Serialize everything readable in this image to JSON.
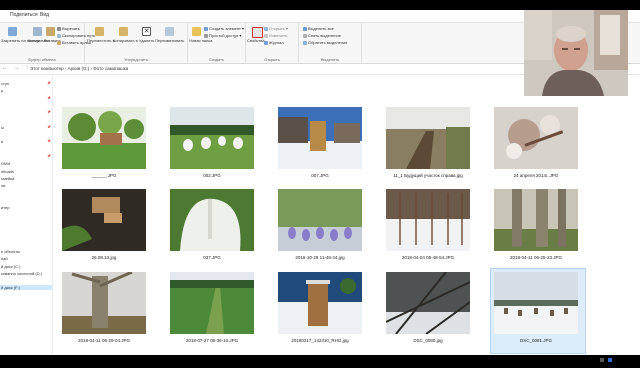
{
  "ribbon_tabs": [
    "Поделиться",
    "Вид"
  ],
  "ribbon": {
    "clipboard": {
      "group_label": "Буфер обмена",
      "pin_label": "Закрепить на панели",
      "copy_label": "Копировать",
      "paste_label": "Вставить",
      "cut_label": "Вырезать",
      "copy_path_label": "Скопировать путь",
      "paste_shortcut_label": "Вставить ярлык"
    },
    "organize": {
      "group_label": "Упорядочить",
      "move_label": "Переместить в",
      "copy_to_label": "Копировать в",
      "delete_label": "Удалить",
      "rename_label": "Переименовать"
    },
    "new": {
      "group_label": "Создать",
      "new_folder_label": "Новая папка",
      "new_item_label": "Создать элемент",
      "easy_access_label": "Простой доступ"
    },
    "open": {
      "group_label": "Открыть",
      "properties_label": "Свойства",
      "open_label": "Открыть",
      "edit_label": "Изменить",
      "history_label": "Журнал"
    },
    "select": {
      "group_label": "Выделить",
      "select_all_label": "Выделить все",
      "select_none_label": "Снять выделение",
      "invert_label": "Обратить выделение"
    }
  },
  "address": {
    "breadcrumb": "Этот компьютер › Архив (G:) › Фото самопашка"
  },
  "nav": {
    "items": [
      "ступ",
      "р",
      "",
      "",
      "",
      "",
      "ы",
      "",
      "в",
      "",
      "",
      "ОМИ",
      "ntloads",
      "смейки",
      "ов",
      "",
      "",
      "итер",
      "",
      "",
      "",
      "",
      "",
      "е объекты",
      "пай",
      "й диск (С:)",
      "кованно сисесной (D:)",
      "",
      "й диск (F:)"
    ],
    "selected_index": 28
  },
  "files": [
    {
      "caption": "______.JPG",
      "scene": "garden"
    },
    {
      "caption": "002.JPG",
      "scene": "field"
    },
    {
      "caption": "007.JPG",
      "scene": "snowhouse"
    },
    {
      "caption": "11_1 Будущий участок справа.jpg",
      "scene": "path"
    },
    {
      "caption": "24 апреля 2014г..JPG",
      "scene": "blossom"
    },
    {
      "caption": "26.08.10.jpg",
      "scene": "dirt"
    },
    {
      "caption": "037.JPG",
      "scene": "white"
    },
    {
      "caption": "2016-10-29 11-48-44.jpg",
      "scene": "purple"
    },
    {
      "caption": "2018-04-04 05-48-54.JPG",
      "scene": "snowrows"
    },
    {
      "caption": "2018-04-11 06-25-23.JPG",
      "scene": "trunks"
    },
    {
      "caption": "2018-04-11 06-29-04.JPG",
      "scene": "bigtree"
    },
    {
      "caption": "2018-07-27 06-36-10.JPG",
      "scene": "grass"
    },
    {
      "caption": "20180317_142310_RHG.jpg",
      "scene": "post"
    },
    {
      "caption": "DSC_0080.jpg",
      "scene": "branches"
    },
    {
      "caption": "DSC_0081.JPG",
      "scene": "winter"
    }
  ],
  "selected_file_index": 14
}
